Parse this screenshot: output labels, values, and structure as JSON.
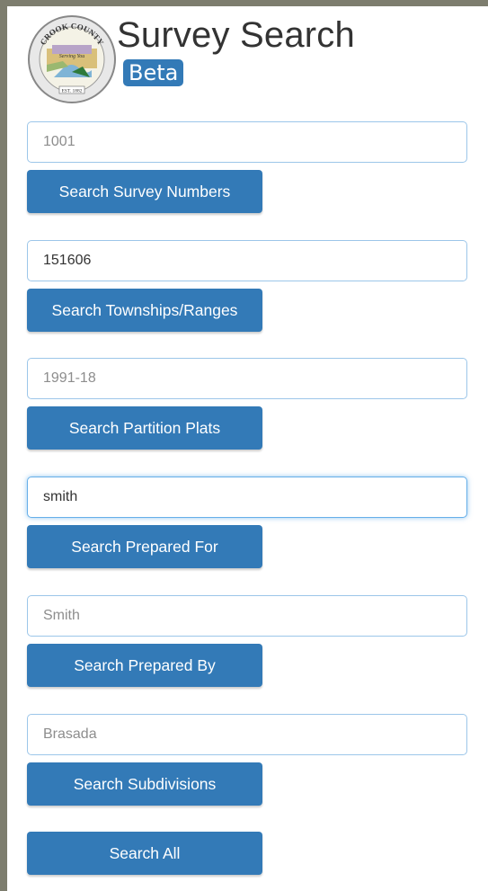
{
  "header": {
    "title": "Survey Search",
    "badge": "Beta",
    "seal": {
      "top_text": "CROOK COUNTY",
      "motto": "Serving You",
      "bottom_text": "EST. 1882"
    }
  },
  "searches": [
    {
      "value": "",
      "placeholder": "1001",
      "button": "Search Survey Numbers"
    },
    {
      "value": "151606",
      "placeholder": "",
      "button": "Search Townships/Ranges"
    },
    {
      "value": "",
      "placeholder": "1991-18",
      "button": "Search Partition Plats"
    },
    {
      "value": "smith",
      "placeholder": "",
      "button": "Search Prepared For"
    },
    {
      "value": "",
      "placeholder": "Smith",
      "button": "Search Prepared By"
    },
    {
      "value": "",
      "placeholder": "Brasada",
      "button": "Search Subdivisions"
    }
  ],
  "search_all": "Search All",
  "colors": {
    "button": "#337ab7",
    "input_border": "#9cc6e9",
    "background": "#7d7d6e"
  }
}
